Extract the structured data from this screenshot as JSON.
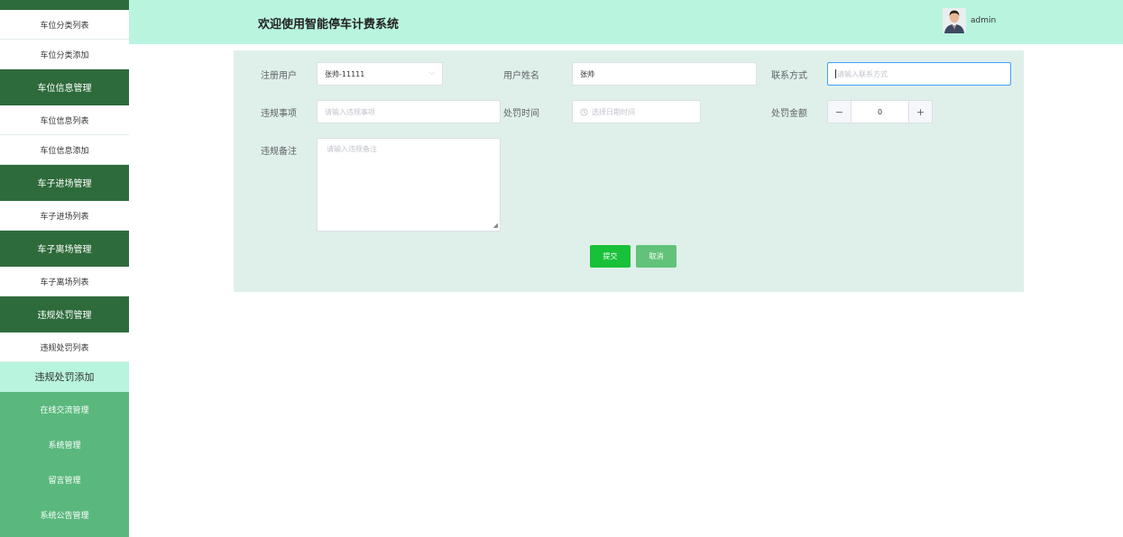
{
  "header": {
    "title": "欢迎使用智能停车计费系统",
    "username": "admin"
  },
  "sidebar": {
    "items": [
      {
        "label": "车位分类列表",
        "type": "light"
      },
      {
        "label": "车位分类添加",
        "type": "light"
      },
      {
        "label": "车位信息管理",
        "type": "dark"
      },
      {
        "label": "车位信息列表",
        "type": "light"
      },
      {
        "label": "车位信息添加",
        "type": "light"
      },
      {
        "label": "车子进场管理",
        "type": "dark"
      },
      {
        "label": "车子进场列表",
        "type": "light"
      },
      {
        "label": "车子离场管理",
        "type": "dark"
      },
      {
        "label": "车子离场列表",
        "type": "light"
      },
      {
        "label": "违规处罚管理",
        "type": "dark"
      },
      {
        "label": "违规处罚列表",
        "type": "light"
      },
      {
        "label": "违规处罚添加",
        "type": "active"
      },
      {
        "label": "在线交流管理",
        "type": "green"
      },
      {
        "label": "系统管理",
        "type": "green"
      },
      {
        "label": "留言管理",
        "type": "green"
      },
      {
        "label": "系统公告管理",
        "type": "green"
      }
    ]
  },
  "form": {
    "registered_user": {
      "label": "注册用户",
      "value": "张帅-11111"
    },
    "user_name": {
      "label": "用户姓名",
      "value": "张帅"
    },
    "contact": {
      "label": "联系方式",
      "placeholder": "请输入联系方式"
    },
    "violation": {
      "label": "违规事项",
      "placeholder": "请输入违规事项"
    },
    "penalty_time": {
      "label": "处罚时间",
      "placeholder": "选择日期时间"
    },
    "penalty_amount": {
      "label": "处罚金额",
      "value": "0",
      "minus": "−",
      "plus": "+"
    },
    "notes": {
      "label": "违规备注",
      "placeholder": "请输入违规备注"
    },
    "submit_label": "提交",
    "cancel_label": "取消"
  },
  "colors": {
    "header_bg": "#b8f4de",
    "sidebar_dark": "#2e6b3b",
    "sidebar_green": "#5ab87d",
    "panel_bg": "#dff0ea",
    "submit": "#19c13a"
  }
}
